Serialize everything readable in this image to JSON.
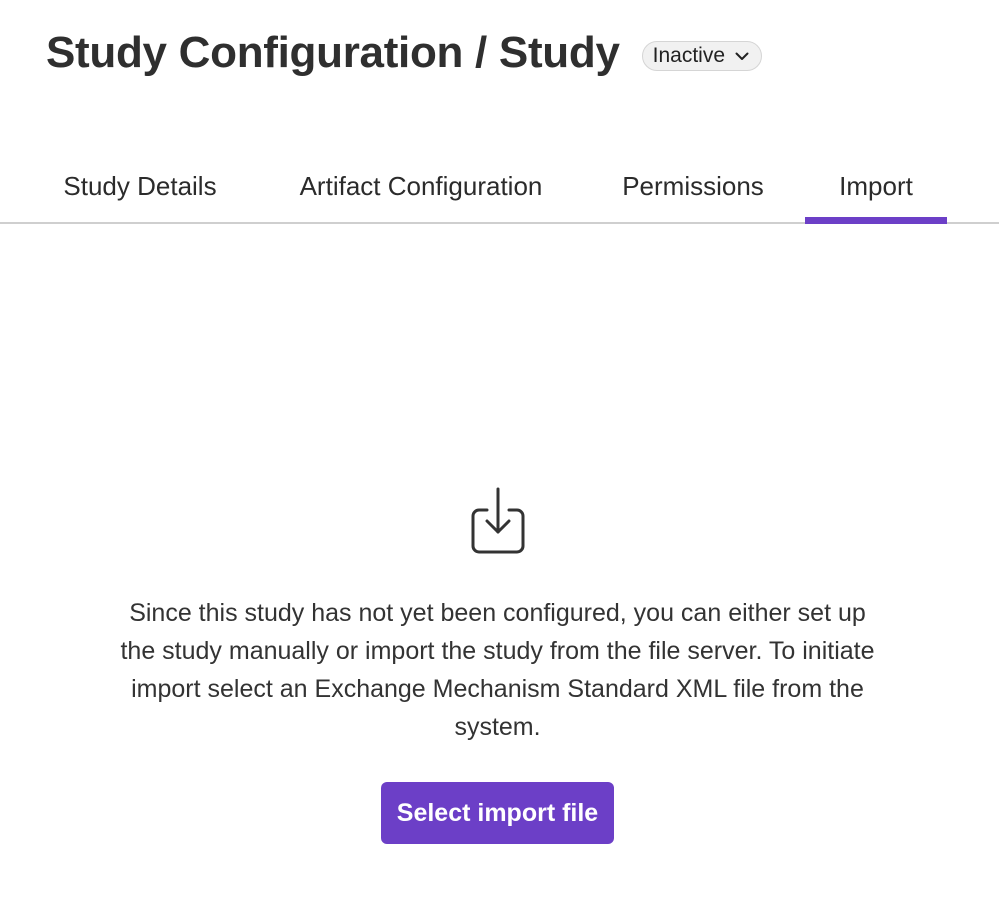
{
  "header": {
    "title": "Study Configuration / Study",
    "status": {
      "selected": "Inactive",
      "icon": "chevron-down-icon"
    }
  },
  "tabs": [
    {
      "label": "Study Details",
      "active": false
    },
    {
      "label": "Artifact Configuration",
      "active": false
    },
    {
      "label": "Permissions",
      "active": false
    },
    {
      "label": "Import",
      "active": true
    }
  ],
  "main": {
    "icon": "import-download-icon",
    "message": "Since this study has not yet been configured, you can either set up the study manually or import the study from the file server. To initiate import select an Exchange Mechanism Standard XML file from the system.",
    "button_label": "Select import file"
  },
  "colors": {
    "accent": "#6c3fc7",
    "text": "#2b2b2b",
    "divider": "#cfcfcf"
  }
}
